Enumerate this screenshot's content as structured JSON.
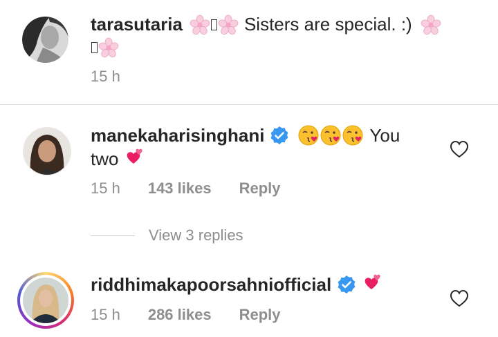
{
  "comments": [
    {
      "username": "tarasutaria",
      "text_main": "Sisters are special. :)",
      "time": "15 h"
    },
    {
      "username": "manekaharisinghani",
      "verified": true,
      "text_main": "You",
      "text_cont": "two",
      "time": "15 h",
      "likes": "143 likes",
      "reply": "Reply"
    },
    {
      "username": "riddhimakapoorsahniofficial",
      "verified": true,
      "time": "15 h",
      "likes": "286 likes",
      "reply": "Reply"
    }
  ],
  "view_replies": "View 3 replies",
  "colors": {
    "username": "#262626",
    "meta": "#8e8e8e",
    "verified": "#3897f0",
    "emoji_heart": "#e0245e",
    "blossom": "#f7c6d9"
  },
  "icons": [
    "cherry-blossom-icon",
    "kissing-face-icon",
    "two-hearts-icon",
    "verified-badge-icon",
    "heart-outline-icon"
  ]
}
